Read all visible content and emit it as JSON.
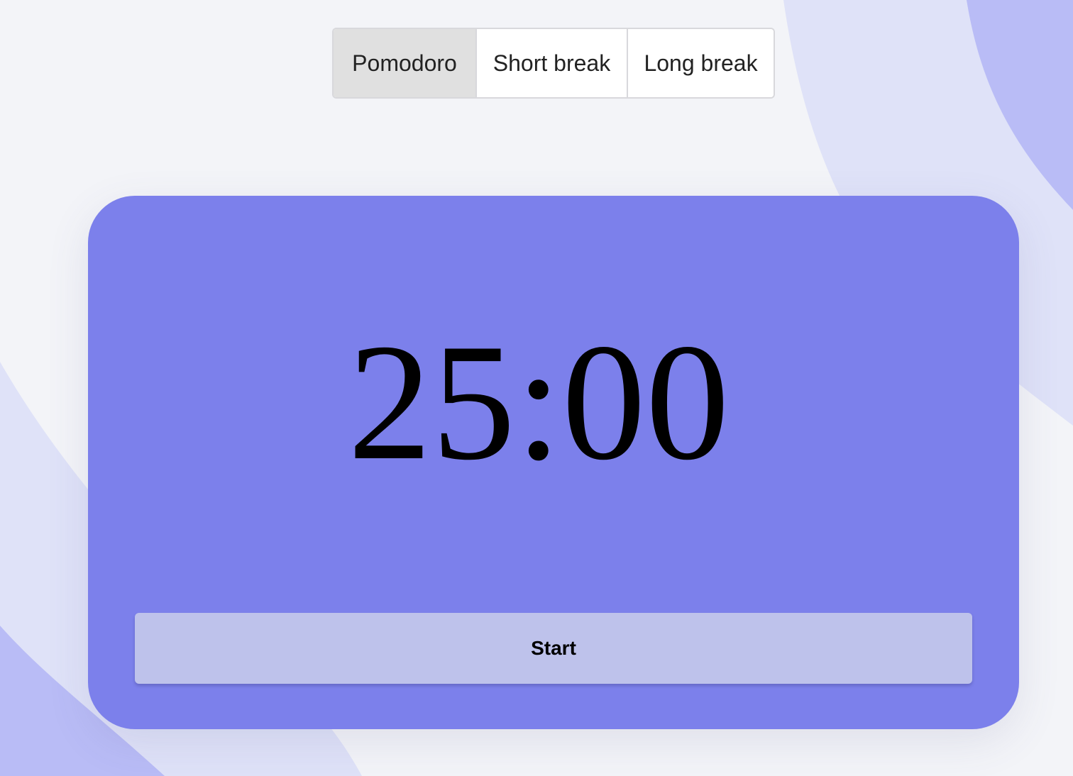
{
  "tabs": [
    {
      "label": "Pomodoro",
      "active": true
    },
    {
      "label": "Short break",
      "active": false
    },
    {
      "label": "Long break",
      "active": false
    }
  ],
  "timer": {
    "time": "25:00"
  },
  "controls": {
    "start_label": "Start"
  },
  "colors": {
    "card": "#7c80eb",
    "start_button": "#bec2eb",
    "page_background": "#f3f4f8",
    "blob_light": "#dfe2f8",
    "blob_medium": "#b9bcf6",
    "active_tab": "#e0e0e0"
  }
}
